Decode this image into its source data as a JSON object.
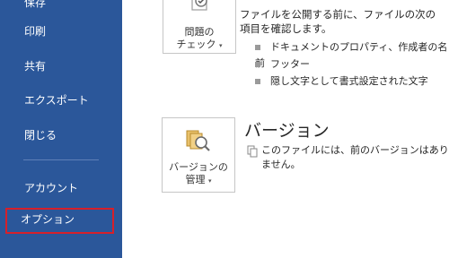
{
  "sidebar": {
    "items": [
      {
        "label": "保存"
      },
      {
        "label": "印刷"
      },
      {
        "label": "共有"
      },
      {
        "label": "エクスポート"
      },
      {
        "label": "閉じる"
      },
      {
        "label": "アカウント"
      },
      {
        "label": "オプション"
      }
    ]
  },
  "inspect": {
    "button_line1": "問題の",
    "button_line2": "チェック",
    "description_line1": "ファイルを公開する前に、ファイルの次の",
    "description_line2": "項目を確認します。",
    "bullets": [
      "ドキュメントのプロパティ、作成者の名前",
      "フッター",
      "隠し文字として書式設定された文字"
    ]
  },
  "versions": {
    "title": "バージョン",
    "button_line1": "バージョンの",
    "button_line2": "管理",
    "info_line1": "このファイルには、前のバージョンはあり",
    "info_line2": "ません。"
  },
  "colors": {
    "sidebar_bg": "#2b579a",
    "highlight_border": "#d6202a"
  }
}
